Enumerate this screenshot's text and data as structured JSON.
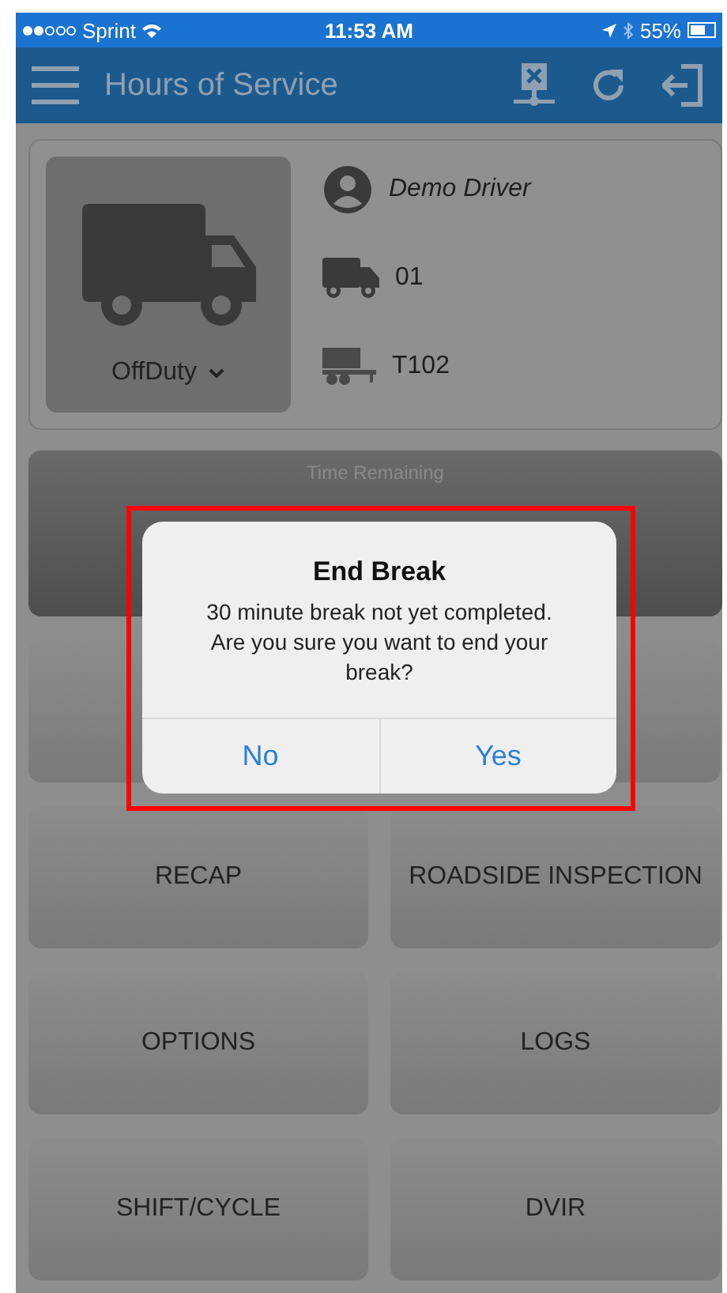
{
  "status_bar": {
    "carrier": "Sprint",
    "time": "11:53 AM",
    "battery": "55%"
  },
  "app_bar": {
    "title": "Hours of Service"
  },
  "driver": {
    "status": "OffDuty",
    "name": "Demo Driver",
    "vehicle": "01",
    "trailer": "T102"
  },
  "time_panel": {
    "label": "Time Remaining"
  },
  "tiles": [
    {
      "label": "RECAP"
    },
    {
      "label": "ROADSIDE INSPECTION"
    },
    {
      "label": "OPTIONS"
    },
    {
      "label": "LOGS"
    },
    {
      "label": "SHIFT/CYCLE"
    },
    {
      "label": "DVIR"
    }
  ],
  "dialog": {
    "title": "End Break",
    "message": "30 minute break not yet completed. Are you sure you want to end your break?",
    "buttons": [
      "No",
      "Yes"
    ]
  }
}
